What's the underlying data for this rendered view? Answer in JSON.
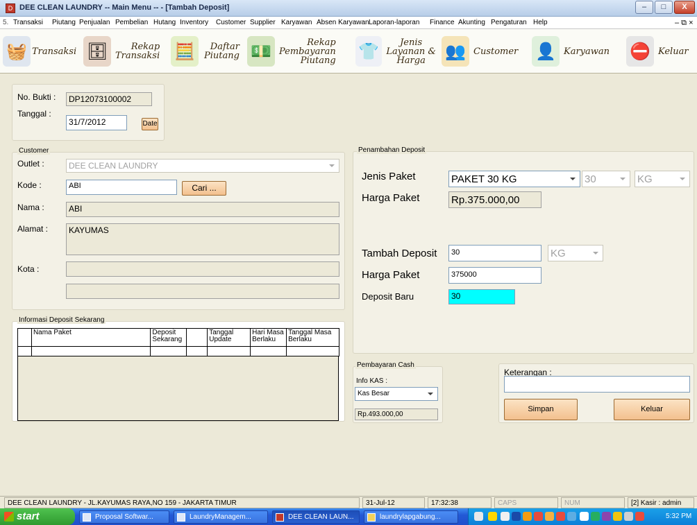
{
  "window": {
    "title": "DEE CLEAN LAUNDRY -- Main Menu -- - [Tambah Deposit]",
    "app_icon": "app-icon",
    "min_label": "–",
    "max_label": "□",
    "close_label": "X"
  },
  "menu": [
    "Transaksi",
    "Piutang",
    "Penjualan",
    "Pembelian",
    "Hutang",
    "Inventory",
    "Customer",
    "Supplier",
    "Karyawan",
    "Absen Karyawan",
    "Laporan-laporan",
    "Finance",
    "Akunting",
    "Pengaturan",
    "Help"
  ],
  "toolbar": [
    {
      "label": "Transaksi",
      "icon": "laundry-icon"
    },
    {
      "label": "Rekap\nTransaksi",
      "icon": "shelf-icon"
    },
    {
      "label": "Daftar\nPiutang",
      "icon": "calculator-icon"
    },
    {
      "label": "Rekap\nPembayaran\nPiutang",
      "icon": "money-icon"
    },
    {
      "label": "Jenis\nLayanan &\nHarga",
      "icon": "tshirt-icon"
    },
    {
      "label": "Customer",
      "icon": "customers-icon"
    },
    {
      "label": "Karyawan",
      "icon": "employee-icon"
    },
    {
      "label": "Keluar",
      "icon": "exit-icon"
    }
  ],
  "doc": {
    "no_bukti_label": "No. Bukti :",
    "no_bukti": "DP12073100002",
    "tanggal_label": "Tanggal :",
    "tanggal": "31/7/2012",
    "date_button": "Date"
  },
  "customer": {
    "legend": "Customer",
    "outlet_label": "Outlet :",
    "outlet": "DEE CLEAN LAUNDRY",
    "kode_label": "Kode :",
    "kode": "ABI",
    "cari_button": "Cari ...",
    "nama_label": "Nama :",
    "nama": "ABI",
    "alamat_label": "Alamat :",
    "alamat": "KAYUMAS",
    "kota_label": "Kota :",
    "kota": "",
    "kota2": ""
  },
  "deposit_info": {
    "legend": "Informasi Deposit Sekarang",
    "columns": [
      "Nama Paket",
      "Deposit Sekarang",
      "",
      "Tanggal Update",
      "Hari Masa Berlaku",
      "Tanggal Masa Berlaku"
    ]
  },
  "penambahan": {
    "legend": "Penambahan Deposit",
    "jenis_paket_label": "Jenis Paket",
    "jenis_paket": "PAKET 30 KG",
    "qty": "30",
    "unit": "KG",
    "harga_paket_label": "Harga Paket",
    "harga_paket": "Rp.375.000,00",
    "tambah_deposit_label": "Tambah Deposit",
    "tambah_deposit": "30",
    "tambah_unit": "KG",
    "harga_paket2_label": "Harga Paket",
    "harga_paket2": "375000",
    "deposit_baru_label": "Deposit Baru",
    "deposit_baru": "30",
    "highlight_color": "#00ffff"
  },
  "pembayaran": {
    "legend": "Pembayaran Cash",
    "info_kas_label": "Info KAS :",
    "kas": "Kas Besar",
    "saldo": "Rp.493.000,00"
  },
  "keterangan": {
    "label": "Keterangan :",
    "value": "",
    "simpan_button": "Simpan",
    "keluar_button": "Keluar"
  },
  "status": {
    "company": "DEE CLEAN LAUNDRY - JL.KAYUMAS RAYA,NO 159 - JAKARTA TIMUR",
    "date": "31-Jul-12",
    "time": "17:32:38",
    "caps": "CAPS",
    "num": "NUM",
    "user": "[2] Kasir : admin"
  },
  "taskbar": {
    "start": "start",
    "tasks": [
      "Proposal Softwar...",
      "LaundryManagem...",
      "DEE CLEAN LAUN...",
      "laundrylapgabung..."
    ],
    "clock": "5:32 PM"
  }
}
